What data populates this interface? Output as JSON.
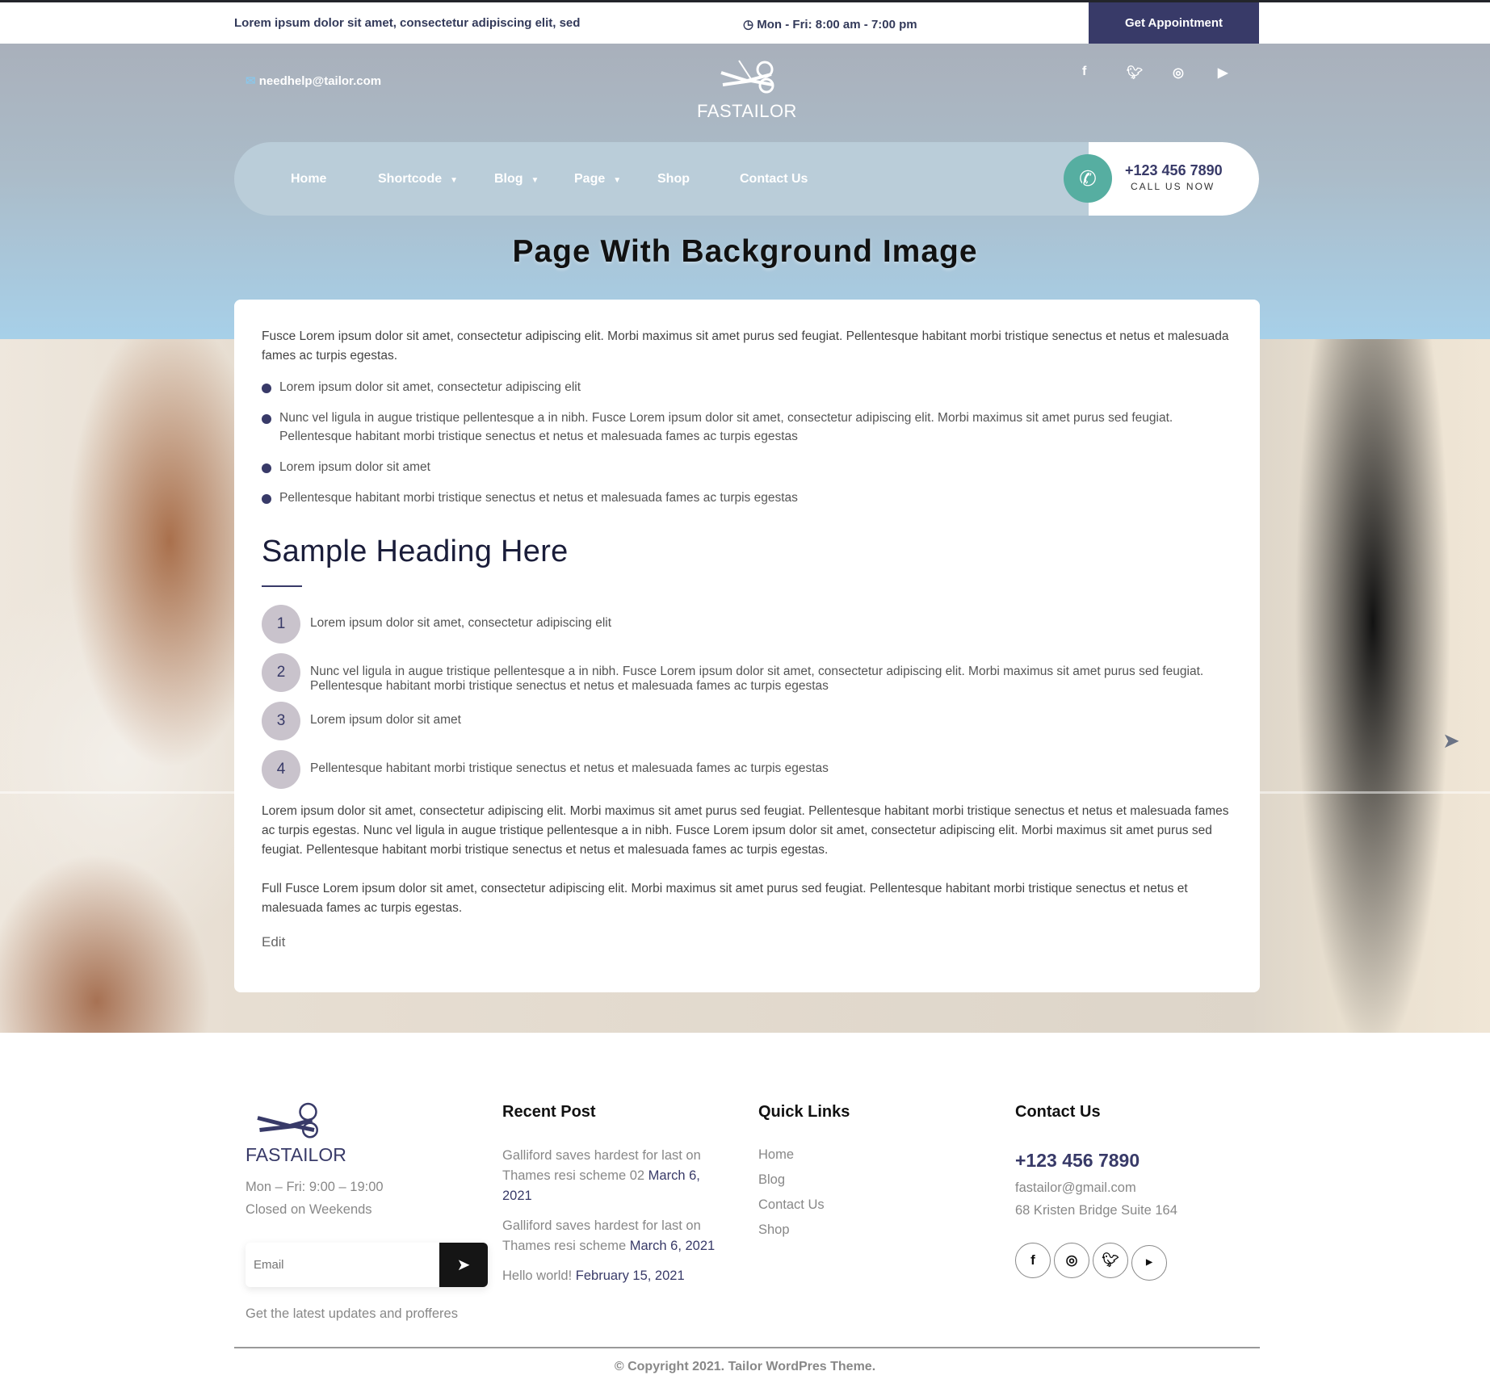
{
  "topbar": {
    "tagline": "Lorem ipsum dolor sit amet, consectetur adipiscing elit, sed",
    "hours": "Mon - Fri: 8:00 am - 7:00 pm",
    "appointment": "Get Appointment"
  },
  "header": {
    "email": "needhelp@tailor.com",
    "logo": "FASTAILOR",
    "social": [
      "facebook-icon",
      "twitter-icon",
      "instagram-icon",
      "youtube-icon"
    ]
  },
  "nav": {
    "items": [
      {
        "label": "Home"
      },
      {
        "label": "Shortcode",
        "dropdown": true
      },
      {
        "label": "Blog",
        "dropdown": true
      },
      {
        "label": "Page",
        "dropdown": true
      },
      {
        "label": "Shop"
      },
      {
        "label": "Contact Us"
      }
    ],
    "phone": "+123 456 7890",
    "call_label": "CALL US NOW"
  },
  "page": {
    "title": "Page With Background Image"
  },
  "content": {
    "intro": "Fusce Lorem ipsum dolor sit amet, consectetur adipiscing elit. Morbi maximus sit amet purus sed feugiat. Pellentesque habitant morbi tristique senectus et netus et malesuada fames ac turpis egestas.",
    "bullets": [
      "Lorem ipsum dolor sit amet, consectetur adipiscing elit",
      "Nunc vel ligula in augue tristique pellentesque a in nibh. Fusce Lorem ipsum dolor sit amet, consectetur adipiscing elit. Morbi maximus sit amet purus sed feugiat. Pellentesque habitant morbi tristique senectus et netus et malesuada fames ac turpis egestas",
      "Lorem ipsum dolor sit amet",
      "Pellentesque habitant morbi tristique senectus et netus et malesuada fames ac turpis egestas"
    ],
    "heading": "Sample Heading Here",
    "numbered": [
      {
        "n": "1",
        "text": "Lorem ipsum dolor sit amet, consectetur adipiscing elit"
      },
      {
        "n": "2",
        "text": "Nunc vel ligula in augue tristique pellentesque a in nibh. Fusce Lorem ipsum dolor sit amet, consectetur adipiscing elit. Morbi maximus sit amet purus sed feugiat. Pellentesque habitant morbi tristique senectus et netus et malesuada fames ac turpis egestas"
      },
      {
        "n": "3",
        "text": "Lorem ipsum dolor sit amet"
      },
      {
        "n": "4",
        "text": "Pellentesque habitant morbi tristique senectus et netus et malesuada fames ac turpis egestas"
      }
    ],
    "para2": "Lorem ipsum dolor sit amet, consectetur adipiscing elit. Morbi maximus sit amet purus sed feugiat. Pellentesque habitant morbi tristique senectus et netus et malesuada fames ac turpis egestas. Nunc vel ligula in augue tristique pellentesque a in nibh. Fusce Lorem ipsum dolor sit amet, consectetur adipiscing elit. Morbi maximus sit amet purus sed feugiat. Pellentesque habitant morbi tristique senectus et netus et malesuada fames ac turpis egestas.",
    "para3": "Full Fusce Lorem ipsum dolor sit amet, consectetur adipiscing elit. Morbi maximus sit amet purus sed feugiat. Pellentesque habitant morbi tristique senectus et netus et malesuada fames ac turpis egestas.",
    "edit": "Edit"
  },
  "footer": {
    "logo": "FASTAILOR",
    "hours": "Mon – Fri: 9:00 – 19:00",
    "closed": "Closed on Weekends",
    "email_placeholder": "Email",
    "newsletter_note": "Get the latest updates and profferes",
    "recent_title": "Recent Post",
    "posts": [
      {
        "title": "Galliford saves hardest for last on Thames resi scheme 02",
        "date": "March 6, 2021"
      },
      {
        "title": "Galliford saves hardest for last on Thames resi scheme",
        "date": "March 6, 2021"
      },
      {
        "title": "Hello world!",
        "date": "February 15, 2021"
      }
    ],
    "links_title": "Quick Links",
    "links": [
      "Home",
      "Blog",
      "Contact Us",
      "Shop"
    ],
    "contact_title": "Contact Us",
    "phone": "+123 456 7890",
    "email": "fastailor@gmail.com",
    "address": "68 Kristen Bridge Suite 164",
    "social": [
      "facebook-icon",
      "instagram-icon",
      "twitter-icon",
      "youtube-icon"
    ],
    "copyright": "© Copyright 2021. Tailor WordPres Theme."
  },
  "colors": {
    "primary": "#383a68",
    "accent": "#56aea1"
  }
}
